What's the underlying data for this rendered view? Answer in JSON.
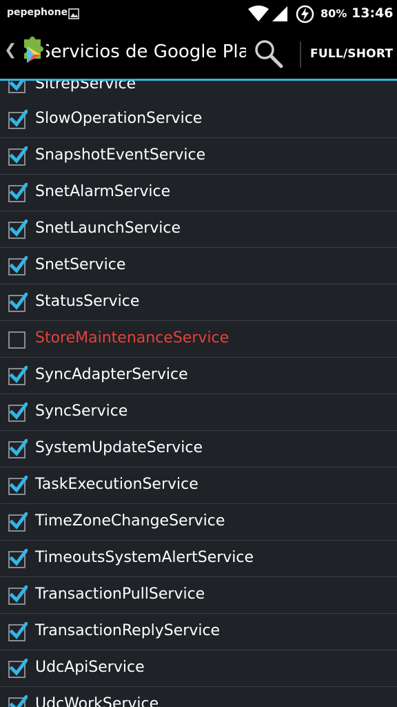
{
  "status_bar": {
    "carrier": "pepephone",
    "battery_pct": "80%",
    "time": "13:46"
  },
  "action_bar": {
    "title": "Servicios de Google Play",
    "full_short_label": "FULL/SHORT"
  },
  "colors": {
    "accent": "#33b5e5",
    "disabled_service": "#e8403a"
  },
  "services": [
    {
      "name": "SitrepService",
      "enabled": true
    },
    {
      "name": "SlowOperationService",
      "enabled": true
    },
    {
      "name": "SnapshotEventService",
      "enabled": true
    },
    {
      "name": "SnetAlarmService",
      "enabled": true
    },
    {
      "name": "SnetLaunchService",
      "enabled": true
    },
    {
      "name": "SnetService",
      "enabled": true
    },
    {
      "name": "StatusService",
      "enabled": true
    },
    {
      "name": "StoreMaintenanceService",
      "enabled": false
    },
    {
      "name": "SyncAdapterService",
      "enabled": true
    },
    {
      "name": "SyncService",
      "enabled": true
    },
    {
      "name": "SystemUpdateService",
      "enabled": true
    },
    {
      "name": "TaskExecutionService",
      "enabled": true
    },
    {
      "name": "TimeZoneChangeService",
      "enabled": true
    },
    {
      "name": "TimeoutsSystemAlertService",
      "enabled": true
    },
    {
      "name": "TransactionPullService",
      "enabled": true
    },
    {
      "name": "TransactionReplyService",
      "enabled": true
    },
    {
      "name": "UdcApiService",
      "enabled": true
    },
    {
      "name": "UdcWorkService",
      "enabled": true
    }
  ]
}
